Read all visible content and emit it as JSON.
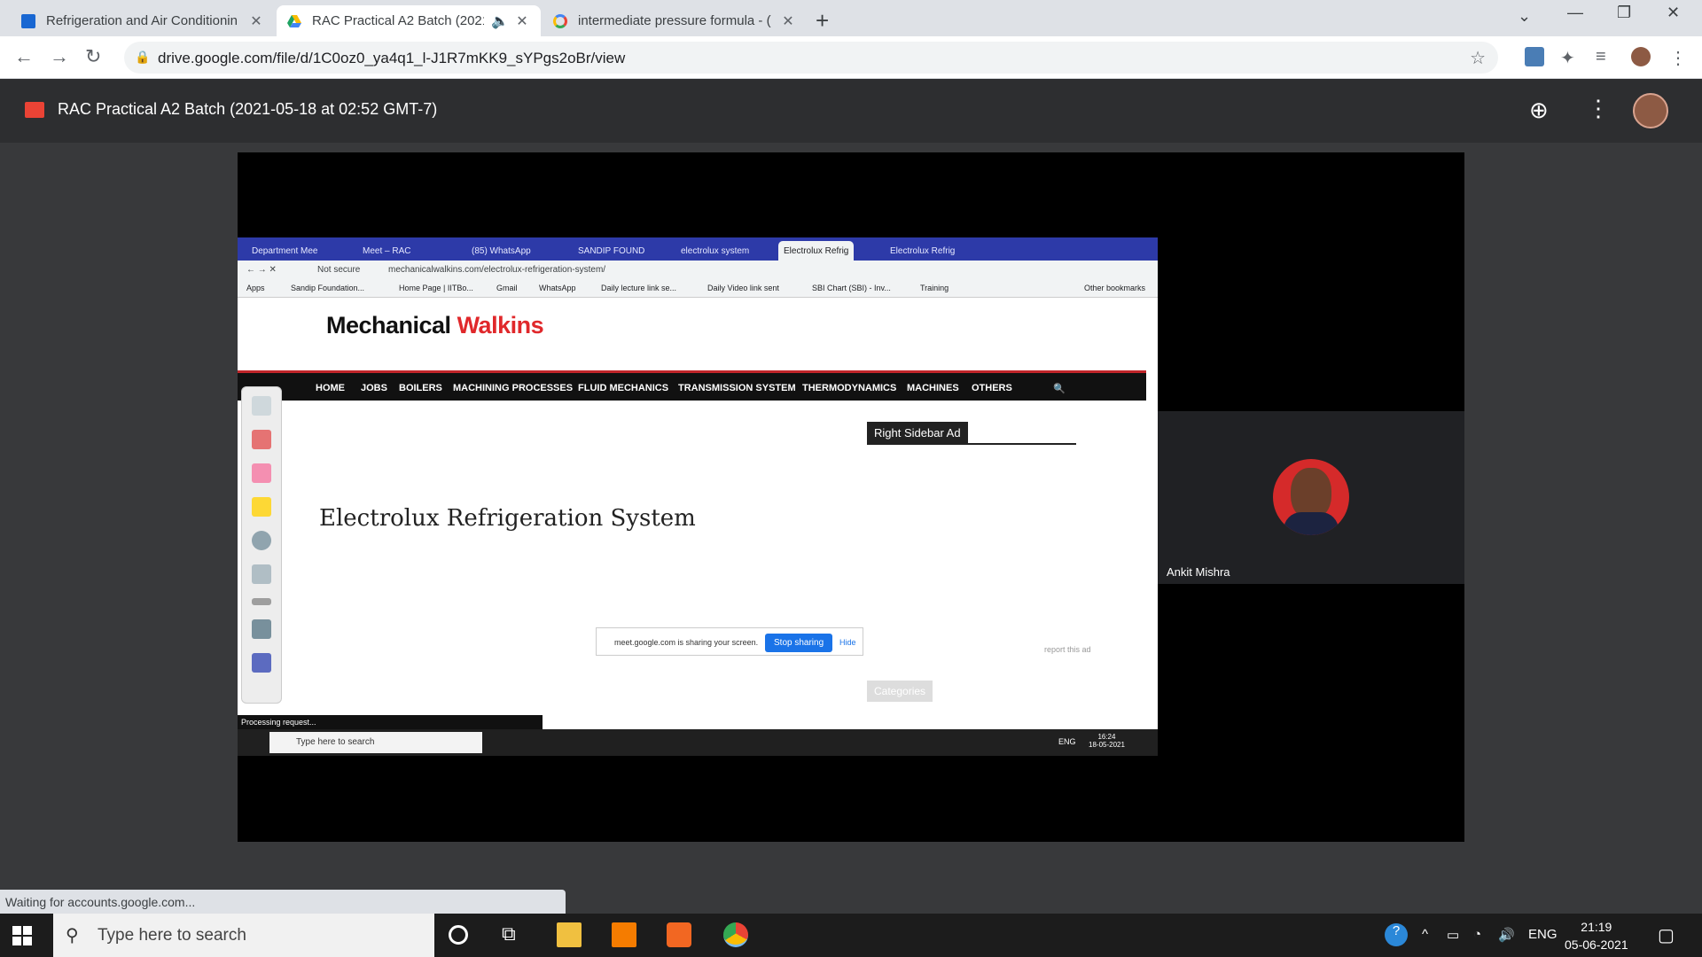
{
  "browser": {
    "tabs": [
      {
        "title": "Refrigeration and Air Conditionin",
        "icon": "classroom-icon"
      },
      {
        "title": "RAC Practical A2 Batch (2021",
        "icon": "drive-icon",
        "active": true
      },
      {
        "title": "intermediate pressure formula - (",
        "icon": "google-icon"
      }
    ],
    "url": "drive.google.com/file/d/1C0oz0_ya4q1_l-J1R7mKK9_sYPgs2oBr/view",
    "status": "Waiting for accounts.google.com..."
  },
  "drive": {
    "title": "RAC Practical A2 Batch (2021-05-18 at 02:52 GMT-7)"
  },
  "shared_screen": {
    "tabs": [
      "Department Mee",
      "Meet – RAC",
      "(85) WhatsApp",
      "SANDIP FOUND",
      "electrolux system",
      "Electrolux Refrig",
      "Electrolux Refrig"
    ],
    "security": "Not secure",
    "url": "mechanicalwalkins.com/electrolux-refrigeration-system/",
    "bookmarks": [
      "Apps",
      "Sandip Foundation...",
      "Home Page | IITBo...",
      "Gmail",
      "WhatsApp",
      "Daily lecture link se...",
      "Daily Video link sent",
      "SBI Chart (SBI) - Inv...",
      "Training",
      "Other bookmarks"
    ],
    "logo_black": "Mechanical",
    "logo_red": "Walkins",
    "nav": [
      "HOME",
      "JOBS",
      "BOILERS",
      "MACHINING PROCESSES",
      "FLUID MECHANICS",
      "TRANSMISSION SYSTEM",
      "THERMODYNAMICS",
      "MACHINES",
      "OTHERS"
    ],
    "page_title": "Electrolux Refrigeration System",
    "sidebar_ad": "Right Sidebar Ad",
    "sharing_msg": "meet.google.com is sharing your screen.",
    "stop_sharing": "Stop sharing",
    "hide": "Hide",
    "report_ad": "report this ad",
    "categories": "Categories",
    "status": "Processing request...",
    "search_placeholder": "Type here to search",
    "lang": "ENG",
    "time": "16:24",
    "date": "18-05-2021"
  },
  "participant": {
    "name": "Ankit Mishra"
  },
  "taskbar": {
    "search_placeholder": "Type here to search",
    "lang": "ENG",
    "time": "21:19",
    "date": "05-06-2021"
  }
}
